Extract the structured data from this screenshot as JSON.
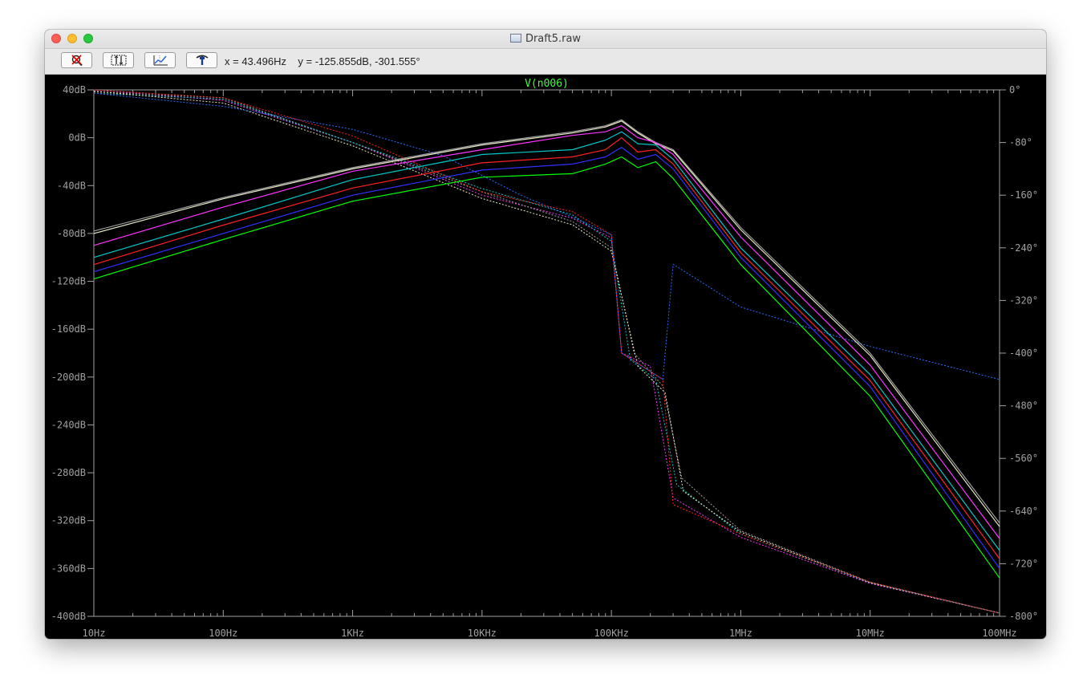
{
  "window": {
    "title": "Draft5.raw"
  },
  "toolbar": {
    "buttons": [
      {
        "name": "zoom-cancel-button",
        "icon": "zoom-cancel-icon"
      },
      {
        "name": "autorange-button",
        "icon": "autorange-icon"
      },
      {
        "name": "mark-data-button",
        "icon": "mark-data-icon"
      },
      {
        "name": "pick-trace-button",
        "icon": "pick-trace-icon"
      }
    ],
    "cursor_x": "x = 43.496Hz",
    "cursor_y": "y = -125.855dB, -301.555°"
  },
  "colors": {
    "background": "#000000",
    "axis": "#a0a0a0",
    "trace_title": "#3cff3c"
  },
  "chart_data": {
    "type": "line",
    "title": "V(n006)",
    "x_scale": "log",
    "xlim": [
      10,
      100000000
    ],
    "x_ticks": [
      {
        "value": 10,
        "label": "10Hz"
      },
      {
        "value": 100,
        "label": "100Hz"
      },
      {
        "value": 1000,
        "label": "1KHz"
      },
      {
        "value": 10000,
        "label": "10KHz"
      },
      {
        "value": 100000,
        "label": "100KHz"
      },
      {
        "value": 1000000,
        "label": "1MHz"
      },
      {
        "value": 10000000,
        "label": "10MHz"
      },
      {
        "value": 100000000,
        "label": "100MHz"
      }
    ],
    "y_left": {
      "unit": "dB",
      "lim": [
        -400,
        40
      ],
      "ticks": [
        {
          "value": 40,
          "label": "40dB"
        },
        {
          "value": 0,
          "label": "0dB"
        },
        {
          "value": -40,
          "label": "-40dB"
        },
        {
          "value": -80,
          "label": "-80dB"
        },
        {
          "value": -120,
          "label": "-120dB"
        },
        {
          "value": -160,
          "label": "-160dB"
        },
        {
          "value": -200,
          "label": "-200dB"
        },
        {
          "value": -240,
          "label": "-240dB"
        },
        {
          "value": -280,
          "label": "-280dB"
        },
        {
          "value": -320,
          "label": "-320dB"
        },
        {
          "value": -360,
          "label": "-360dB"
        },
        {
          "value": -400,
          "label": "-400dB"
        }
      ]
    },
    "y_right": {
      "unit": "deg",
      "lim": [
        -800,
        0
      ],
      "ticks": [
        {
          "value": 0,
          "label": "0°"
        },
        {
          "value": -80,
          "label": "-80°"
        },
        {
          "value": -160,
          "label": "-160°"
        },
        {
          "value": -240,
          "label": "-240°"
        },
        {
          "value": -320,
          "label": "-320°"
        },
        {
          "value": -400,
          "label": "-400°"
        },
        {
          "value": -480,
          "label": "-480°"
        },
        {
          "value": -560,
          "label": "-560°"
        },
        {
          "value": -640,
          "label": "-640°"
        },
        {
          "value": -720,
          "label": "-720°"
        },
        {
          "value": -800,
          "label": "-800°"
        }
      ]
    },
    "grid": false,
    "magnitude_series": [
      {
        "color": "#a0a0a0",
        "points": [
          [
            10,
            -78
          ],
          [
            100,
            -50
          ],
          [
            1000,
            -25
          ],
          [
            10000,
            -5
          ],
          [
            50000,
            5
          ],
          [
            90000,
            10
          ],
          [
            120000,
            15
          ],
          [
            160000,
            5
          ],
          [
            220000,
            -4
          ],
          [
            300000,
            -10
          ],
          [
            1000000,
            -75
          ],
          [
            10000000,
            -180
          ],
          [
            100000000,
            -322
          ]
        ]
      },
      {
        "color": "#e8e8c8",
        "points": [
          [
            10,
            -80
          ],
          [
            100,
            -51
          ],
          [
            1000,
            -26
          ],
          [
            10000,
            -6
          ],
          [
            50000,
            4
          ],
          [
            90000,
            9
          ],
          [
            120000,
            14
          ],
          [
            160000,
            4
          ],
          [
            220000,
            -5
          ],
          [
            300000,
            -11
          ],
          [
            1000000,
            -77
          ],
          [
            10000000,
            -182
          ],
          [
            100000000,
            -325
          ]
        ]
      },
      {
        "color": "#ff33ff",
        "points": [
          [
            10,
            -90
          ],
          [
            100,
            -58
          ],
          [
            1000,
            -28
          ],
          [
            10000,
            -10
          ],
          [
            50000,
            2
          ],
          [
            90000,
            5
          ],
          [
            120000,
            10
          ],
          [
            160000,
            0
          ],
          [
            220000,
            -4
          ],
          [
            300000,
            -14
          ],
          [
            1000000,
            -83
          ],
          [
            10000000,
            -190
          ],
          [
            100000000,
            -335
          ]
        ]
      },
      {
        "color": "#00c8c8",
        "points": [
          [
            10,
            -100
          ],
          [
            100,
            -68
          ],
          [
            1000,
            -35
          ],
          [
            10000,
            -14
          ],
          [
            50000,
            -10
          ],
          [
            90000,
            -2
          ],
          [
            120000,
            5
          ],
          [
            160000,
            -5
          ],
          [
            220000,
            -6
          ],
          [
            300000,
            -18
          ],
          [
            1000000,
            -92
          ],
          [
            10000000,
            -198
          ],
          [
            100000000,
            -345
          ]
        ]
      },
      {
        "color": "#ff2020",
        "points": [
          [
            10,
            -106
          ],
          [
            100,
            -73
          ],
          [
            1000,
            -42
          ],
          [
            10000,
            -21
          ],
          [
            50000,
            -16
          ],
          [
            90000,
            -10
          ],
          [
            120000,
            0
          ],
          [
            160000,
            -12
          ],
          [
            220000,
            -10
          ],
          [
            300000,
            -22
          ],
          [
            1000000,
            -96
          ],
          [
            10000000,
            -203
          ],
          [
            100000000,
            -352
          ]
        ]
      },
      {
        "color": "#3030ff",
        "points": [
          [
            10,
            -112
          ],
          [
            100,
            -80
          ],
          [
            1000,
            -48
          ],
          [
            10000,
            -27
          ],
          [
            50000,
            -22
          ],
          [
            90000,
            -16
          ],
          [
            120000,
            -8
          ],
          [
            160000,
            -18
          ],
          [
            220000,
            -14
          ],
          [
            300000,
            -26
          ],
          [
            1000000,
            -100
          ],
          [
            10000000,
            -208
          ],
          [
            100000000,
            -360
          ]
        ]
      },
      {
        "color": "#00ff00",
        "points": [
          [
            10,
            -118
          ],
          [
            100,
            -85
          ],
          [
            1000,
            -53
          ],
          [
            10000,
            -33
          ],
          [
            50000,
            -30
          ],
          [
            90000,
            -22
          ],
          [
            120000,
            -16
          ],
          [
            160000,
            -25
          ],
          [
            220000,
            -20
          ],
          [
            300000,
            -34
          ],
          [
            1000000,
            -106
          ],
          [
            10000000,
            -216
          ],
          [
            100000000,
            -368
          ]
        ]
      }
    ],
    "phase_series": [
      {
        "color": "#ff33ff",
        "points": [
          [
            10,
            0
          ],
          [
            100,
            -16
          ],
          [
            1000,
            -80
          ],
          [
            10000,
            -160
          ],
          [
            50000,
            -195
          ],
          [
            100000,
            -225
          ],
          [
            120000,
            -400
          ],
          [
            200000,
            -420
          ],
          [
            300000,
            -620
          ],
          [
            1000000,
            -680
          ],
          [
            10000000,
            -750
          ],
          [
            100000000,
            -795
          ]
        ]
      },
      {
        "color": "#a0a0a0",
        "points": [
          [
            10,
            -3
          ],
          [
            100,
            -12
          ],
          [
            1000,
            -80
          ],
          [
            10000,
            -155
          ],
          [
            50000,
            -200
          ],
          [
            100000,
            -240
          ],
          [
            150000,
            -400
          ],
          [
            250000,
            -450
          ],
          [
            350000,
            -590
          ],
          [
            1000000,
            -670
          ],
          [
            10000000,
            -748
          ],
          [
            100000000,
            -795
          ]
        ]
      },
      {
        "color": "#00c8c8",
        "points": [
          [
            10,
            -5
          ],
          [
            100,
            -14
          ],
          [
            1000,
            -80
          ],
          [
            10000,
            -150
          ],
          [
            50000,
            -190
          ],
          [
            100000,
            -230
          ],
          [
            140000,
            -410
          ],
          [
            220000,
            -440
          ],
          [
            320000,
            -600
          ],
          [
            1000000,
            -675
          ],
          [
            10000000,
            -749
          ],
          [
            100000000,
            -795
          ]
        ]
      },
      {
        "color": "#e8e8c8",
        "points": [
          [
            10,
            -2
          ],
          [
            100,
            -20
          ],
          [
            1000,
            -85
          ],
          [
            10000,
            -165
          ],
          [
            50000,
            -205
          ],
          [
            100000,
            -245
          ],
          [
            160000,
            -420
          ],
          [
            260000,
            -460
          ],
          [
            360000,
            -610
          ],
          [
            1000000,
            -672
          ],
          [
            10000000,
            -749
          ],
          [
            100000000,
            -795
          ]
        ]
      },
      {
        "color": "#2a6aff",
        "points": [
          [
            10,
            -5
          ],
          [
            100,
            -25
          ],
          [
            1000,
            -60
          ],
          [
            5000,
            -100
          ],
          [
            20000,
            -160
          ],
          [
            60000,
            -200
          ],
          [
            100000,
            -220
          ],
          [
            120000,
            -400
          ],
          [
            250000,
            -440
          ],
          [
            300000,
            -265
          ],
          [
            1000000,
            -330
          ],
          [
            10000000,
            -390
          ],
          [
            100000000,
            -440
          ]
        ]
      },
      {
        "color": "#ff2020",
        "points": [
          [
            10,
            0
          ],
          [
            100,
            -12
          ],
          [
            1000,
            -70
          ],
          [
            10000,
            -155
          ],
          [
            50000,
            -185
          ],
          [
            100000,
            -220
          ],
          [
            120000,
            -400
          ],
          [
            250000,
            -440
          ],
          [
            300000,
            -630
          ],
          [
            1000000,
            -675
          ],
          [
            10000000,
            -748
          ],
          [
            100000000,
            -795
          ]
        ]
      }
    ]
  }
}
